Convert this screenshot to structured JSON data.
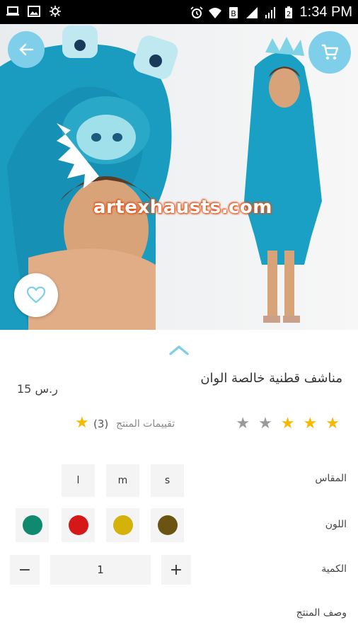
{
  "status_bar": {
    "time": "1:34 PM",
    "icons": [
      "laptop-icon",
      "image-icon",
      "brightness-icon",
      "alarm-icon",
      "wifi-icon",
      "battery-saver-icon",
      "signal-icon",
      "signal-icon",
      "battery-icon"
    ]
  },
  "hero": {
    "watermark": "artexhausts.com",
    "back_icon": "arrow-left-icon",
    "cart_icon": "cart-icon",
    "favorite_icon": "heart-icon"
  },
  "product": {
    "title": "مناشف قطنية خالصة الوان",
    "price": "15 ر.س",
    "rating_stars": 3,
    "rating_max": 5,
    "rating_label": "تقييمات المنتج",
    "rating_count": "(3)"
  },
  "options": {
    "size_label": "المقاس",
    "sizes": [
      "s",
      "m",
      "l"
    ],
    "color_label": "اللون",
    "colors": [
      "#6b5412",
      "#d4b20a",
      "#d51717",
      "#0f8a6e"
    ],
    "quantity_label": "الكمية",
    "quantity_value": "1",
    "minus": "−",
    "plus": "+",
    "description_label": "وصف المنتج"
  },
  "colors": {
    "accent": "#7fcfea",
    "star_on": "#f6b800",
    "star_off": "#999999"
  }
}
